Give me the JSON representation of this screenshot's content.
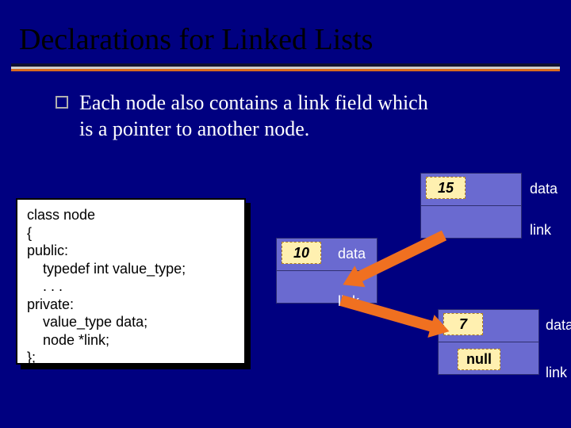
{
  "title": "Declarations for Linked Lists",
  "bullet": "Each node also contains a link field which is a pointer to another node.",
  "code": {
    "l1": "class node",
    "l2": "{",
    "l3": "public:",
    "l4": "    typedef int value_type;",
    "l5": "    . . .",
    "l6": "private:",
    "l7": "    value_type data;",
    "l8": "    node *link;",
    "l9": "};"
  },
  "labels": {
    "data": "data",
    "link": "link",
    "null": "null"
  },
  "nodes": {
    "a": {
      "value": "15"
    },
    "b": {
      "value": "10"
    },
    "c": {
      "value": "7"
    }
  }
}
